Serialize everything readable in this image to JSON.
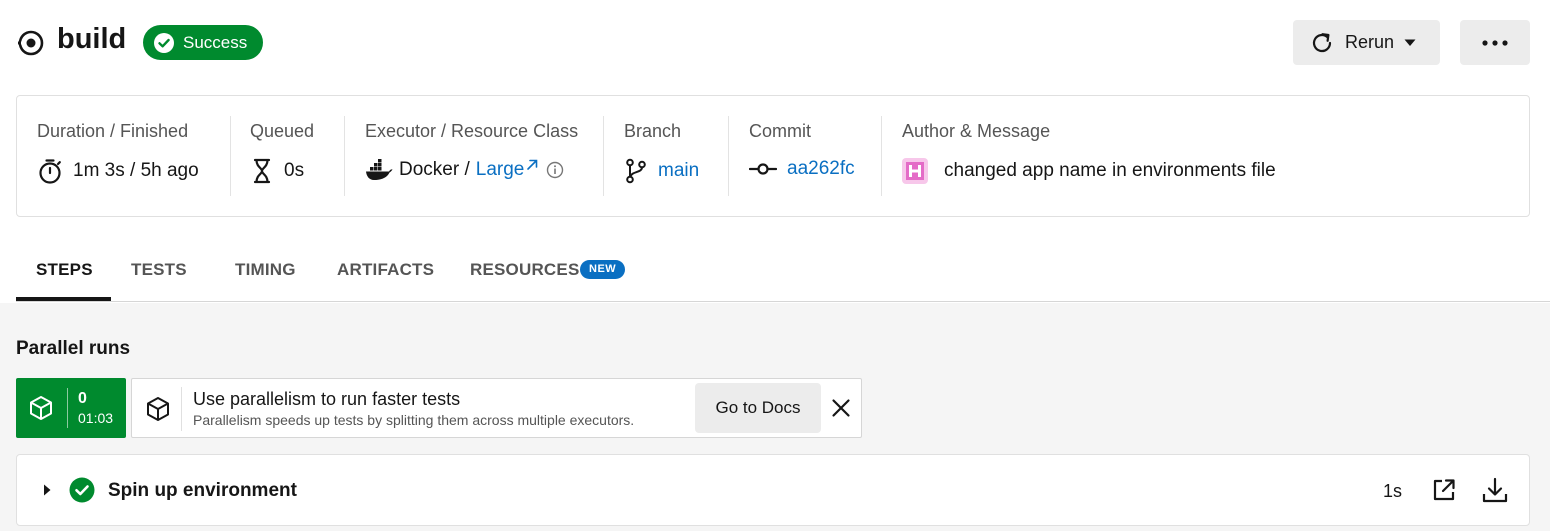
{
  "header": {
    "title": "build",
    "status": "Success",
    "rerun_label": "Rerun",
    "icons": {
      "job": "workflow-job-icon",
      "status": "check-circle-icon",
      "rerun": "refresh-icon",
      "more": "more-horizontal-icon"
    }
  },
  "colors": {
    "success": "#008a2e",
    "link": "#0a6fc2",
    "button_bg": "#ececec",
    "content_bg": "#f5f5f5"
  },
  "info": {
    "duration": {
      "label": "Duration / Finished",
      "value": "1m 3s / 5h ago",
      "icon": "stopwatch-icon"
    },
    "queued": {
      "label": "Queued",
      "value": "0s",
      "icon": "hourglass-icon"
    },
    "executor": {
      "label": "Executor / Resource Class",
      "executor": "Docker /",
      "resource_class": "Large",
      "icon": "docker-icon"
    },
    "branch": {
      "label": "Branch",
      "value": "main",
      "icon": "git-branch-icon"
    },
    "commit": {
      "label": "Commit",
      "value": "aa262fc",
      "icon": "git-commit-icon"
    },
    "author": {
      "label": "Author & Message",
      "message": "changed app name in environments file",
      "icon": "avatar"
    }
  },
  "tabs": [
    {
      "label": "STEPS",
      "active": true
    },
    {
      "label": "TESTS",
      "active": false
    },
    {
      "label": "TIMING",
      "active": false
    },
    {
      "label": "ARTIFACTS",
      "active": false
    },
    {
      "label": "RESOURCES",
      "active": false,
      "badge": "NEW"
    }
  ],
  "parallel": {
    "title": "Parallel runs",
    "run": {
      "index": "0",
      "time": "01:03"
    },
    "promo": {
      "title": "Use parallelism to run faster tests",
      "subtitle": "Parallelism speeds up tests by splitting them across multiple executors.",
      "button": "Go to Docs"
    }
  },
  "steps": [
    {
      "name": "Spin up environment",
      "duration": "1s",
      "status": "success"
    }
  ]
}
